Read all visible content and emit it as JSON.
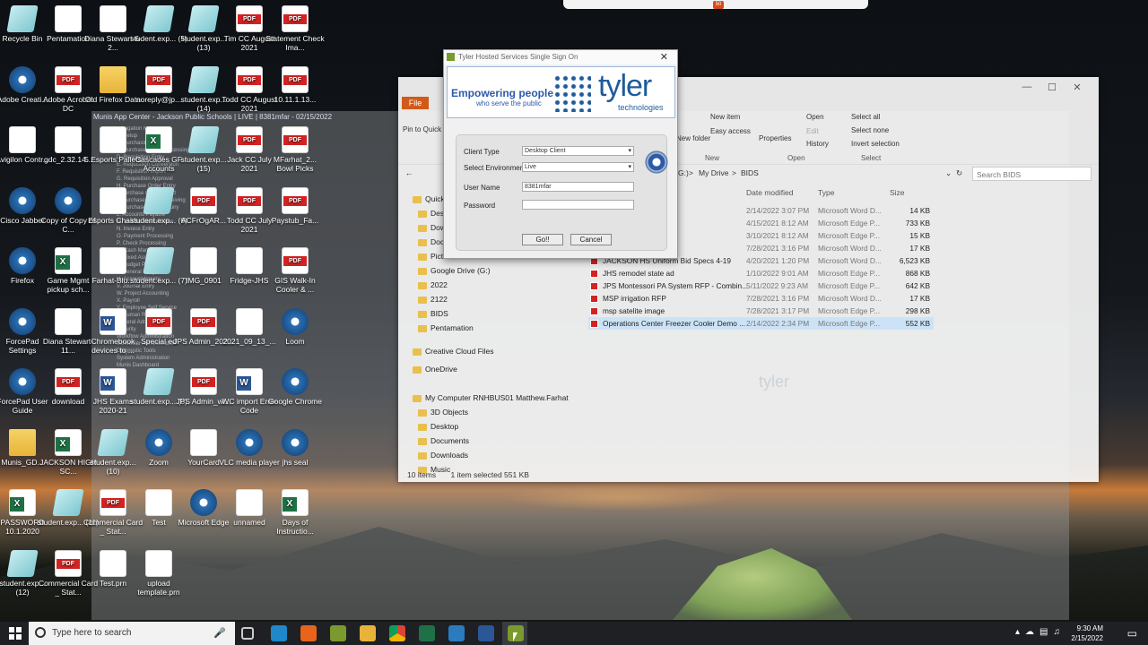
{
  "desktop_icons": [
    {
      "label": "Recycle Bin",
      "kind": "glass"
    },
    {
      "label": "Pentamation",
      "kind": "doc"
    },
    {
      "label": "Diana Stewart-6-2...",
      "kind": "doc"
    },
    {
      "label": "student.exp... (5)",
      "kind": "glass"
    },
    {
      "label": "student.exp... (13)",
      "kind": "glass"
    },
    {
      "label": "Tim CC August 2021",
      "kind": "pdf"
    },
    {
      "label": "Statement Check Ima...",
      "kind": "pdf"
    },
    {
      "label": "Adobe Creati...",
      "kind": "circle"
    },
    {
      "label": "Adobe Acrobat DC",
      "kind": "pdf"
    },
    {
      "label": "Old Firefox Data",
      "kind": "folder"
    },
    {
      "label": "noreply@jp...",
      "kind": "pdf"
    },
    {
      "label": "student.exp... (14)",
      "kind": "glass"
    },
    {
      "label": "Todd CC August 2021",
      "kind": "pdf"
    },
    {
      "label": "10.11.1.13...",
      "kind": "pdf"
    },
    {
      "label": "Avigilon Contr...",
      "kind": "doc"
    },
    {
      "label": "gdc_2.32.14...",
      "kind": "doc"
    },
    {
      "label": "5 Esports Pallets",
      "kind": "doc"
    },
    {
      "label": "Cascades GF Accounts",
      "kind": "excel"
    },
    {
      "label": "student.exp... (15)",
      "kind": "glass"
    },
    {
      "label": "Jack CC July 2021",
      "kind": "pdf"
    },
    {
      "label": "MFarhat_2... Bowl Picks",
      "kind": "pdf"
    },
    {
      "label": "Cisco Jabber",
      "kind": "circle"
    },
    {
      "label": "Copy of Copy of C...",
      "kind": "circle"
    },
    {
      "label": "Esports Chairs",
      "kind": "doc"
    },
    {
      "label": "student.exp... (6)",
      "kind": "glass"
    },
    {
      "label": "ACFrOgAR...",
      "kind": "pdf"
    },
    {
      "label": "Todd CC July 2021",
      "kind": "pdf"
    },
    {
      "label": "Paystub_Fa...",
      "kind": "pdf"
    },
    {
      "label": "Firefox",
      "kind": "circle"
    },
    {
      "label": "Game Mgmt pickup sch...",
      "kind": "excel"
    },
    {
      "label": "Farhat-Blu...",
      "kind": "doc"
    },
    {
      "label": "student.exp... (7)",
      "kind": "glass"
    },
    {
      "label": "IMG_0901",
      "kind": "doc"
    },
    {
      "label": "Fridge-JHS",
      "kind": "doc"
    },
    {
      "label": "GIS Walk-In Cooler & ...",
      "kind": "pdf"
    },
    {
      "label": "ForcePad Settings",
      "kind": "circle"
    },
    {
      "label": "Diana Stewart-11...",
      "kind": "doc"
    },
    {
      "label": "Chromebook devices to ...",
      "kind": "word"
    },
    {
      "label": "Special ed",
      "kind": "pdf"
    },
    {
      "label": "JPS Admin_202...",
      "kind": "pdf"
    },
    {
      "label": "2021_09_13_...",
      "kind": "doc"
    },
    {
      "label": "Loom",
      "kind": "circle"
    },
    {
      "label": "ForcePad User Guide",
      "kind": "circle"
    },
    {
      "label": "download",
      "kind": "pdf"
    },
    {
      "label": "JHS Exams 2020-21",
      "kind": "word"
    },
    {
      "label": "student.exp... (8)",
      "kind": "glass"
    },
    {
      "label": "JPS Admin_wi...",
      "kind": "pdf"
    },
    {
      "label": "WC import Error Code",
      "kind": "word"
    },
    {
      "label": "Google Chrome",
      "kind": "circle"
    },
    {
      "label": "Munis_GD...",
      "kind": "folder"
    },
    {
      "label": "JACKSON HIGH SC...",
      "kind": "excel"
    },
    {
      "label": "student.exp... (10)",
      "kind": "glass"
    },
    {
      "label": "Zoom",
      "kind": "circle"
    },
    {
      "label": "YourCard",
      "kind": "doc"
    },
    {
      "label": "VLC media player",
      "kind": "circle"
    },
    {
      "label": "jhs seal",
      "kind": "circle"
    },
    {
      "label": "PASSWORD 10.1.2020",
      "kind": "excel"
    },
    {
      "label": "student.exp... (11)",
      "kind": "glass"
    },
    {
      "label": "Commercial Card _ Stat...",
      "kind": "pdf"
    },
    {
      "label": "Test",
      "kind": "doc"
    },
    {
      "label": "Microsoft Edge",
      "kind": "circle"
    },
    {
      "label": "unnamed",
      "kind": "doc"
    },
    {
      "label": "Days of Instructio...",
      "kind": "excel"
    },
    {
      "label": "student.exp... (12)",
      "kind": "glass"
    },
    {
      "label": "Commercial Card _ Stat...",
      "kind": "pdf"
    },
    {
      "label": "Test.prn",
      "kind": "doc"
    },
    {
      "label": "upload template.prn",
      "kind": "doc"
    }
  ],
  "background_app": {
    "title": "Munis App Center - Jackson Public Schools | LIVE | 8381mfar - 02/15/2022",
    "menu_lines": [
      "Navigation Menu",
      "A. Setup",
      "B. Purchasing",
      "C. Purchase Order Processing",
      "D. Requisition Entry",
      "E. Requisition Conversion",
      "F. Requisition Import",
      "G. Requisition Approval",
      "H. Purchase Order Entry",
      "I. Purchase Order Import",
      "J. Purchase Order Receiving",
      "K. Purchase Order Inquiry",
      "L. Accounts Payable",
      "M. Vendor Maintenance",
      "N. Invoice Entry",
      "O. Payment Processing",
      "P. Check Processing",
      "Q. Cash Management",
      "R. Fixed Assets",
      "S. Budget Processing",
      "T. General Ledger",
      "U. Account Inquiry",
      "V. Journal Entry",
      "W. Project Accounting",
      "X. Payroll",
      "Y. Employee Self Service",
      "Z. Human Resources",
      "General Administration",
      "Security",
      "Workflow Administration",
      "Scheduler Administration",
      "Diagnostic Tools",
      "System Administration",
      "Munis Dashboard"
    ],
    "watermark_munis": "munis",
    "watermark_tyler": "tyler"
  },
  "explorer": {
    "file_tab": "File",
    "ribbon": {
      "pin_label": "Pin to Quick access",
      "new_item": "New item",
      "easy_access": "Easy access",
      "new_folder": "New folder",
      "properties": "Properties",
      "open": "Open",
      "edit": "Edit",
      "history": "History",
      "select_all": "Select all",
      "select_none": "Select none",
      "invert_selection": "Invert selection",
      "group_new": "New",
      "group_open": "Open",
      "group_select": "Select"
    },
    "path": {
      "part1": "G:)",
      "sep1": ">",
      "part2": "My Drive",
      "sep2": ">",
      "part3": "BIDS"
    },
    "search_placeholder": "Search BIDS",
    "columns": {
      "date": "Date modified",
      "type": "Type",
      "size": "Size"
    },
    "nav": [
      "Quick access",
      "Desktop",
      "Downloads",
      "Documents",
      "Pictures",
      "Google Drive (G:)",
      "2022",
      "2122",
      "BIDS",
      "Pentamation",
      "Creative Cloud Files",
      "OneDrive",
      "My Computer RNHBUS01 Matthew.Farhat",
      "3D Objects",
      "Desktop",
      "Documents",
      "Downloads",
      "Music"
    ],
    "rows": [
      {
        "name": "and Cooler - NE...",
        "date": "2/14/2022 3:07 PM",
        "type": "Microsoft Word D...",
        "size": "14 KB",
        "sel": false
      },
      {
        "name": "e",
        "date": "4/15/2021 8:12 AM",
        "type": "Microsoft Edge P...",
        "size": "733 KB",
        "sel": false
      },
      {
        "name": "d Advertisement",
        "date": "3/10/2021 8:12 AM",
        "type": "Microsoft Edge P...",
        "size": "15 KB",
        "sel": false
      },
      {
        "name": "",
        "date": "7/28/2021 3:16 PM",
        "type": "Microsoft Word D...",
        "size": "17 KB",
        "sel": false
      },
      {
        "name": "JACKSON HS Uniform Bid Specs 4-19",
        "date": "4/20/2021 1:20 PM",
        "type": "Microsoft Word D...",
        "size": "6,523 KB",
        "sel": false
      },
      {
        "name": "JHS remodel state ad",
        "date": "1/10/2022 9:01 AM",
        "type": "Microsoft Edge P...",
        "size": "868 KB",
        "sel": false
      },
      {
        "name": "JPS Montessori PA System RFP - Combin...",
        "date": "5/11/2022 9:23 AM",
        "type": "Microsoft Edge P...",
        "size": "642 KB",
        "sel": false
      },
      {
        "name": "MSP irrigation RFP",
        "date": "7/28/2021 3:16 PM",
        "type": "Microsoft Word D...",
        "size": "17 KB",
        "sel": false
      },
      {
        "name": "msp satelite image",
        "date": "7/28/2021 3:17 PM",
        "type": "Microsoft Edge P...",
        "size": "298 KB",
        "sel": false
      },
      {
        "name": "Operations Center Freezer Cooler Demo ...",
        "date": "2/14/2022 2:34 PM",
        "type": "Microsoft Edge P...",
        "size": "552 KB",
        "sel": true
      }
    ],
    "status_items": "10 items",
    "status_selected": "1 item selected  551 KB"
  },
  "sso": {
    "title": "Tyler Hosted Services Single Sign On",
    "empowering": "Empowering people",
    "serve": "who serve the public",
    "tyler": "tyler",
    "technologies": "technologies",
    "client_type_label": "Client Type",
    "client_type_value": "Desktop Client",
    "environment_label": "Select Environment",
    "environment_value": "Live",
    "username_label": "User Name",
    "username_value": "8381mfar",
    "password_label": "Password",
    "password_value": "",
    "go_label": "Go!!",
    "cancel_label": "Cancel"
  },
  "taskbar": {
    "search_placeholder": "Type here to search",
    "time": "9:30 AM",
    "date": "2/15/2022"
  },
  "colors": {
    "accent": "#d05a1a",
    "tyler_blue": "#1e5c9a",
    "taskbar": "#1f2024"
  }
}
